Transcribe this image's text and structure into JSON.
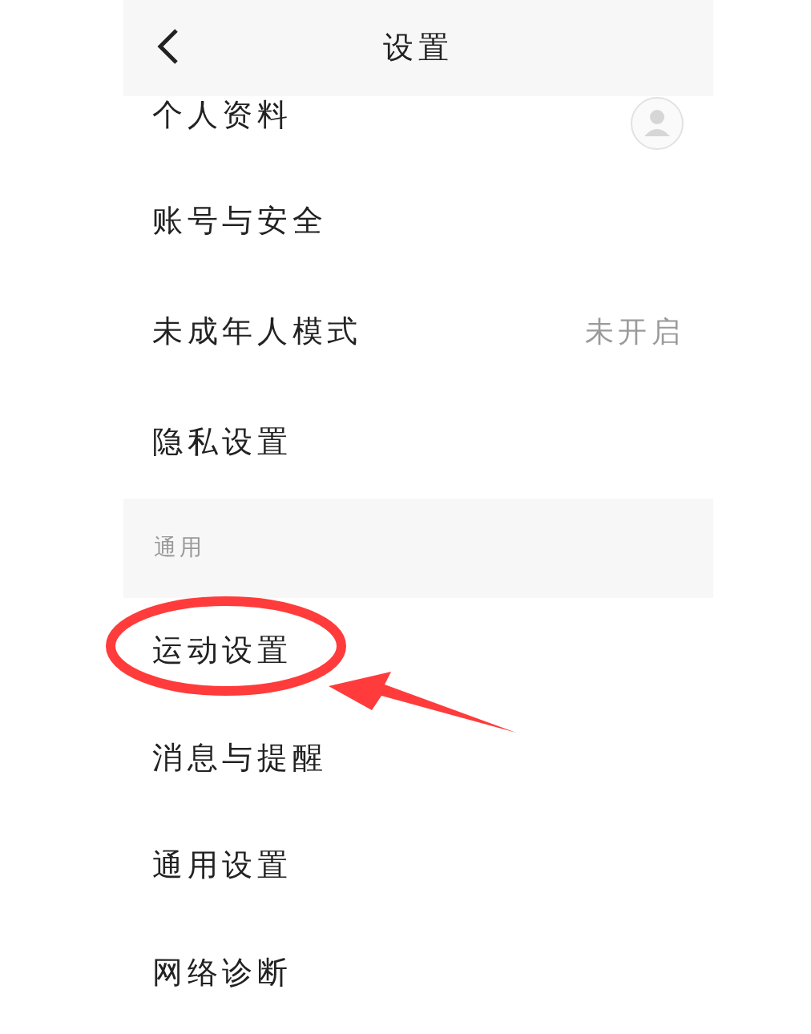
{
  "header": {
    "title": "设置"
  },
  "rows": [
    {
      "kind": "avatar",
      "label": "个人资料"
    },
    {
      "kind": "plain",
      "label": "账号与安全"
    },
    {
      "kind": "value",
      "label": "未成年人模式",
      "value": "未开启"
    },
    {
      "kind": "plain",
      "label": "隐私设置"
    },
    {
      "kind": "section",
      "label": "通用"
    },
    {
      "kind": "plain",
      "label": "运动设置"
    },
    {
      "kind": "plain",
      "label": "消息与提醒"
    },
    {
      "kind": "plain",
      "label": "通用设置"
    },
    {
      "kind": "plain",
      "label": "网络诊断"
    }
  ]
}
